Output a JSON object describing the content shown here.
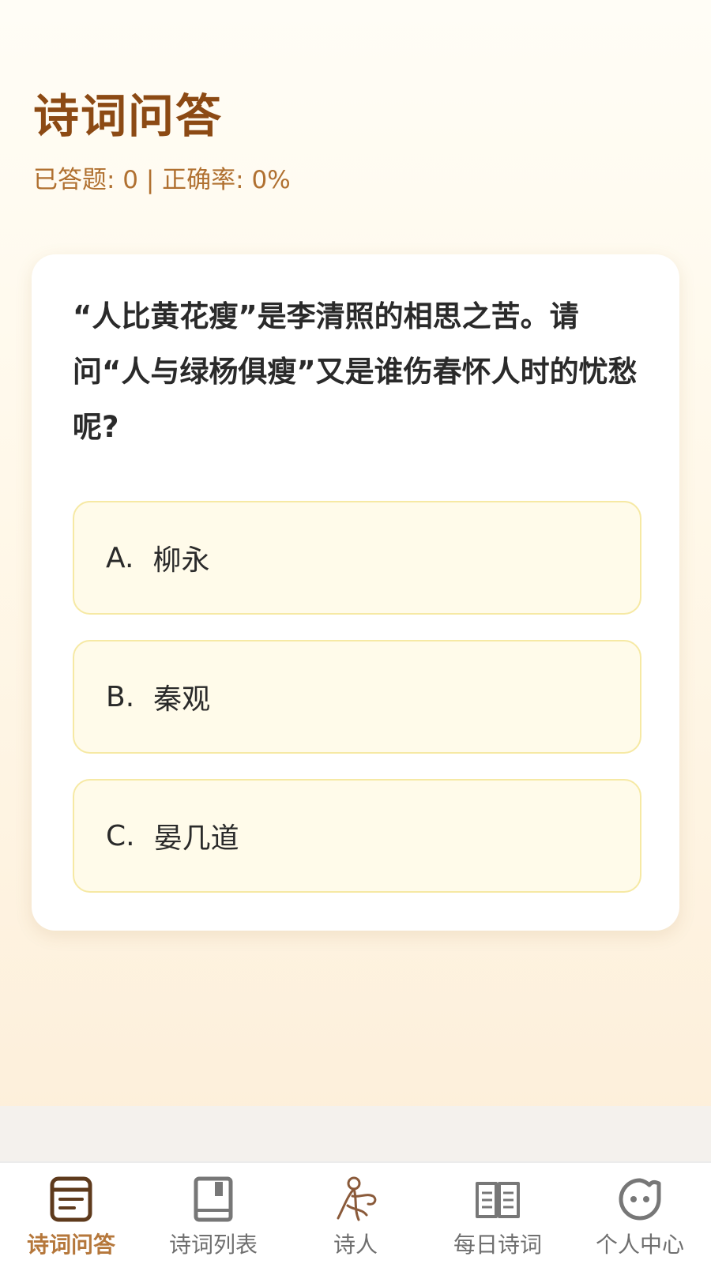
{
  "header": {
    "title": "诗词问答",
    "stats": "已答题: 0 | 正确率: 0%"
  },
  "quiz": {
    "question": "“人比黄花瘦”是李清照的相思之苦。请问“人与绿杨俱瘦”又是谁伤春怀人时的忧愁呢?",
    "options": [
      {
        "letter": "A.",
        "text": "柳永"
      },
      {
        "letter": "B.",
        "text": "秦观"
      },
      {
        "letter": "C.",
        "text": "晏几道"
      }
    ]
  },
  "tabbar": {
    "tabs": [
      {
        "label": "诗词问答",
        "icon": "quiz-icon",
        "active": true
      },
      {
        "label": "诗词列表",
        "icon": "book-icon",
        "active": false
      },
      {
        "label": "诗人",
        "icon": "poet-icon",
        "active": false
      },
      {
        "label": "每日诗词",
        "icon": "open-book-icon",
        "active": false
      },
      {
        "label": "个人中心",
        "icon": "profile-face-icon",
        "active": false
      }
    ]
  },
  "colors": {
    "accent": "#8c4a14",
    "active_tab": "#b5773b",
    "option_bg": "#fffbea",
    "option_border": "#f6e9a4"
  }
}
